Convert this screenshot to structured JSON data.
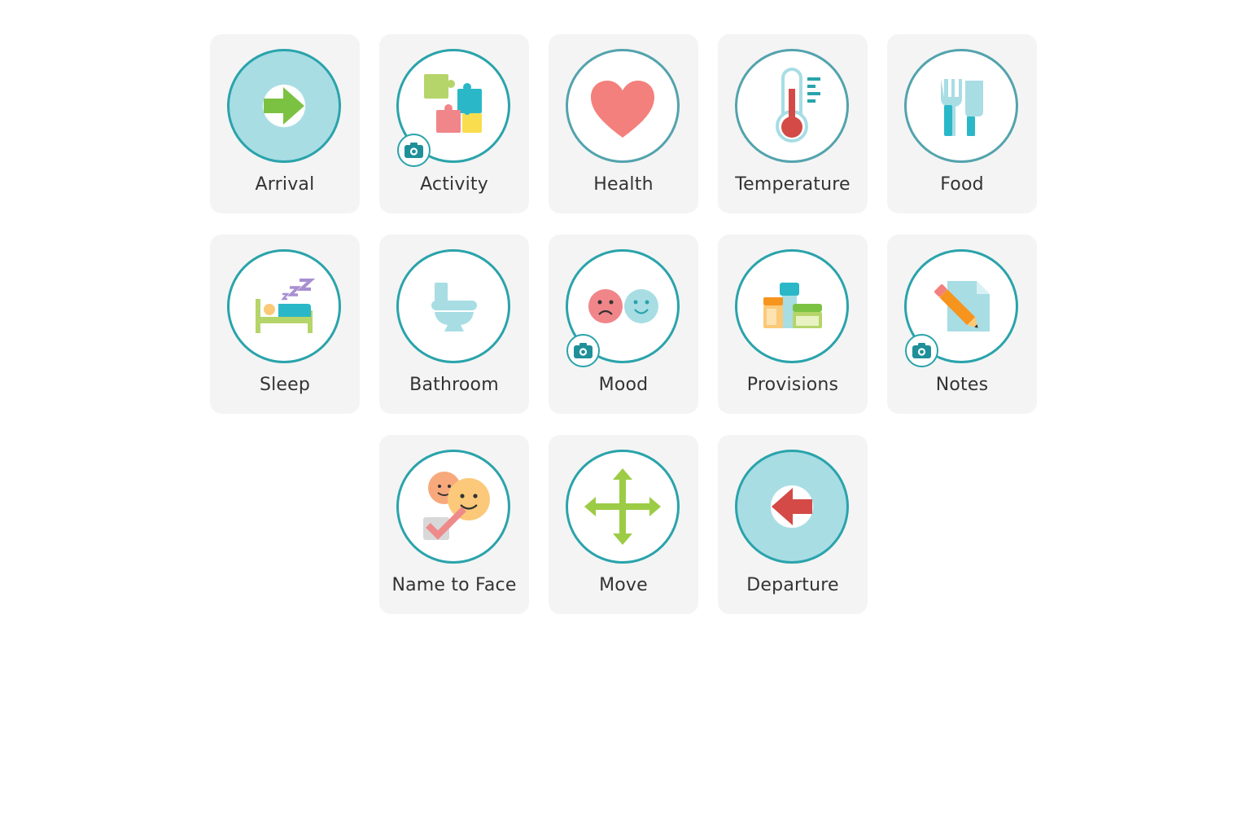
{
  "tiles": [
    {
      "label": "Arrival",
      "icon": "arrival-arrow-icon",
      "camera": false
    },
    {
      "label": "Activity",
      "icon": "puzzle-icon",
      "camera": true
    },
    {
      "label": "Health",
      "icon": "heart-icon",
      "camera": false
    },
    {
      "label": "Temperature",
      "icon": "thermometer-icon",
      "camera": false
    },
    {
      "label": "Food",
      "icon": "fork-knife-icon",
      "camera": false
    },
    {
      "label": "Sleep",
      "icon": "bed-icon",
      "camera": false
    },
    {
      "label": "Bathroom",
      "icon": "toilet-icon",
      "camera": false
    },
    {
      "label": "Mood",
      "icon": "mood-faces-icon",
      "camera": true
    },
    {
      "label": "Provisions",
      "icon": "provisions-icon",
      "camera": false
    },
    {
      "label": "Notes",
      "icon": "note-pencil-icon",
      "camera": true
    },
    {
      "label": "Name to Face",
      "icon": "name-to-face-icon",
      "camera": false
    },
    {
      "label": "Move",
      "icon": "move-arrows-icon",
      "camera": false
    },
    {
      "label": "Departure",
      "icon": "departure-arrow-icon",
      "camera": false
    }
  ],
  "colors": {
    "ring": "#2aa3ab",
    "tile_bg": "#f4f4f4",
    "text": "#333333"
  }
}
